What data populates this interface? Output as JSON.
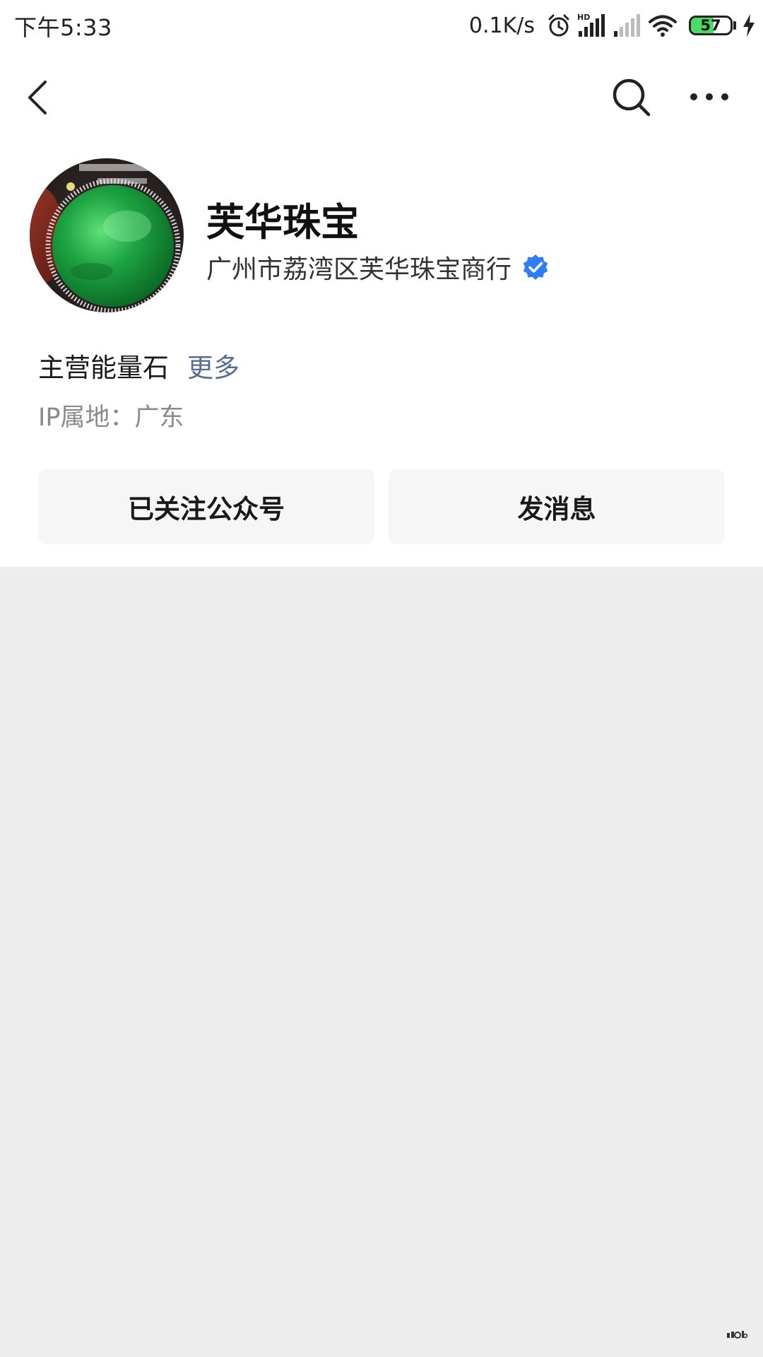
{
  "status_bar": {
    "time": "下午5:33",
    "net_speed": "0.1K/s",
    "battery_level": "57",
    "battery_percent": 57,
    "icons": [
      "alarm-icon",
      "hd-signal-icon",
      "signal-icon",
      "wifi-icon",
      "charging-icon"
    ]
  },
  "nav": {
    "back_icon": "chevron-left-icon",
    "search_icon": "search-icon",
    "more_icon": "more-dots-icon"
  },
  "profile": {
    "name": "芙华珠宝",
    "company": "广州市荔湾区芙华珠宝商行",
    "verified_color": "#2e7cf6",
    "intro": "主营能量石",
    "intro_more": "更多",
    "ip_location": "IP属地：广东"
  },
  "actions": {
    "follow_label": "已关注公众号",
    "message_label": "发消息"
  },
  "colors": {
    "link": "#576b95",
    "background": "#ededed",
    "card": "#ffffff",
    "button": "#f6f6f6"
  }
}
